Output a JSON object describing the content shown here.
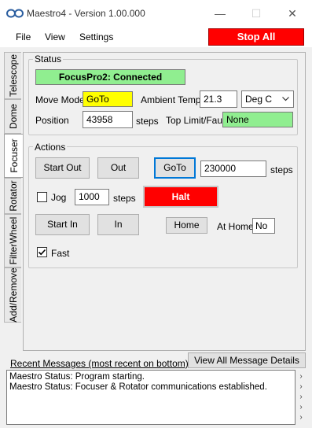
{
  "window": {
    "title": "Maestro4 - Version 1.00.000",
    "minimize": "—",
    "maximize": "☐",
    "close": "✕"
  },
  "menu": {
    "file": "File",
    "view": "View",
    "settings": "Settings",
    "stop_all": "Stop All"
  },
  "tabs": [
    "Telescope",
    "Dome",
    "Focuser",
    "Rotator",
    "FilterWheel",
    "Add/Remove"
  ],
  "status": {
    "group_label": "Status",
    "connection": "FocusPro2: Connected",
    "move_mode_label": "Move Mode",
    "move_mode_value": "GoTo",
    "ambient_temp_label": "Ambient Temp",
    "ambient_temp_value": "21.3",
    "temp_unit": "Deg C",
    "position_label": "Position",
    "position_value": "43958",
    "position_unit": "steps",
    "top_limit_label": "Top Limit/Fault",
    "top_limit_value": "None"
  },
  "actions": {
    "group_label": "Actions",
    "start_out": "Start Out",
    "out": "Out",
    "goto": "GoTo",
    "goto_value": "230000",
    "goto_unit": "steps",
    "jog_label": "Jog",
    "jog_value": "1000",
    "jog_unit": "steps",
    "halt": "Halt",
    "start_in": "Start In",
    "in": "In",
    "home": "Home",
    "at_home_label": "At Home",
    "at_home_value": "No",
    "fast_label": "Fast"
  },
  "messages": {
    "label": "Recent Messages (most recent on bottom)",
    "view_all": "View All Message Details",
    "line1": "Maestro Status: Program starting.",
    "line2": "Maestro Status: Focuser & Rotator communications established."
  },
  "colors": {
    "connected_bg": "#90ee90",
    "move_mode_bg": "#ffff00",
    "halt_bg": "#ff0000",
    "stop_all_bg": "#ff0000"
  }
}
